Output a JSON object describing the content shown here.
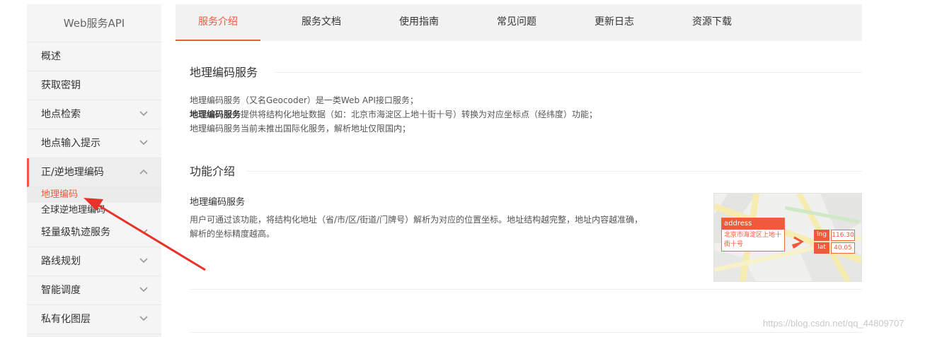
{
  "sidebar": {
    "title": "Web服务API",
    "items": [
      {
        "label": "概述"
      },
      {
        "label": "获取密钥"
      },
      {
        "label": "地点检索"
      },
      {
        "label": "地点输入提示"
      },
      {
        "label": "正/逆地理编码"
      },
      {
        "label": "轻量级轨迹服务"
      },
      {
        "label": "路线规划"
      },
      {
        "label": "智能调度"
      },
      {
        "label": "私有化图层"
      }
    ],
    "sub_items": [
      {
        "label": "地理编码"
      },
      {
        "label": "全球逆地理编码"
      }
    ]
  },
  "tabs": [
    {
      "label": "服务介绍"
    },
    {
      "label": "服务文档"
    },
    {
      "label": "使用指南"
    },
    {
      "label": "常见问题"
    },
    {
      "label": "更新日志"
    },
    {
      "label": "资源下载"
    }
  ],
  "main": {
    "section1_title": "地理编码服务",
    "intro_lines": [
      "地理编码服务（又名Geocoder）是一类Web API接口服务；",
      "提供将结构化地址数据（如：北京市海淀区上地十街十号）转换为对应坐标点（经纬度）功能；",
      "地理编码服务当前未推出国际化服务，解析地址仅限国内；"
    ],
    "intro_bold": "地理编码服务",
    "section2_title": "功能介绍",
    "feature_title": "地理编码服务",
    "feature_lines": [
      "用户可通过该功能，将结构化地址（省/市/区/街道/门牌号）解析为对应的位置坐标。地址结构越完整，地址内容越准确，",
      "解析的坐标精度越高。"
    ]
  },
  "illustration": {
    "address_label": "address",
    "address_text": "北京市海淀区上地十街十号",
    "lng_label": "lng",
    "lng_value": "116.30",
    "lat_label": "lat",
    "lat_value": "40.05"
  },
  "watermark": "https://blog.csdn.net/qq_44809707",
  "colors": {
    "accent": "#ef5a3a",
    "sidebar_bg": "#f2f2f2",
    "annotation_arrow": "#e8332a"
  }
}
